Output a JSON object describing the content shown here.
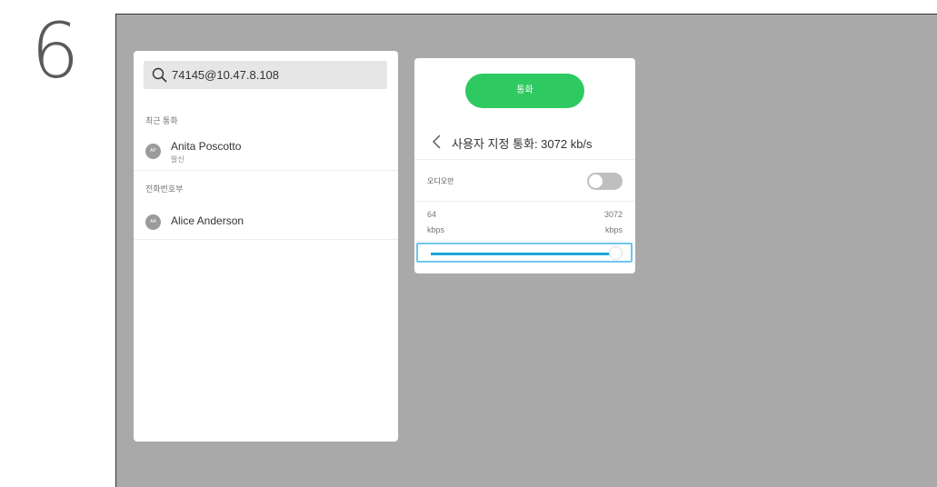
{
  "step_number": "6",
  "search": {
    "icon": "search-icon",
    "value": "74145@10.47.8.108"
  },
  "recent": {
    "label": "최근 통화",
    "contacts": [
      {
        "initials": "AP",
        "name": "Anita Poscotto",
        "status": "발신"
      }
    ]
  },
  "directory": {
    "label": "전화번호부",
    "contacts": [
      {
        "initials": "AA",
        "name": "Alice Anderson"
      }
    ]
  },
  "call_panel": {
    "call_button": "통화",
    "call_button_color": "#2fc961",
    "back_icon": "chevron-left-icon",
    "title": "사용자 지정 통화: 3072 kb/s",
    "audio_only_label": "오디오만",
    "audio_only_on": false,
    "range_min_value": "64",
    "range_min_unit": "kbps",
    "range_max_value": "3072",
    "range_max_unit": "kbps",
    "rate_fraction": 1.0,
    "slider_color": "#19a7d9"
  }
}
